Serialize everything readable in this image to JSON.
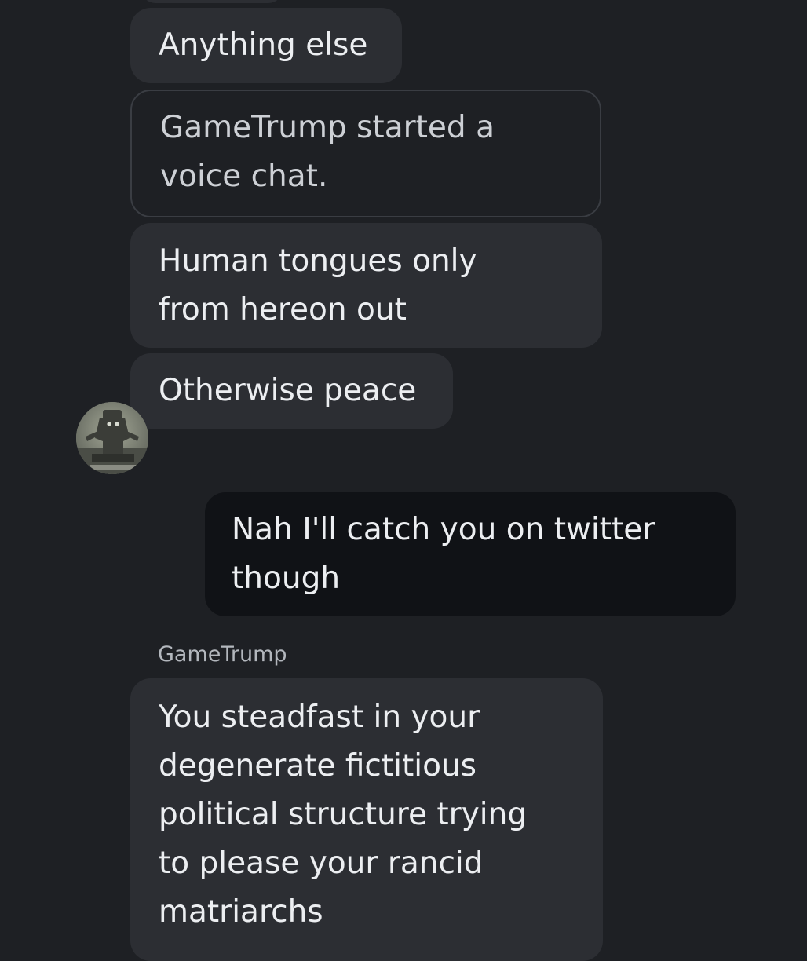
{
  "conversation": {
    "messages": [
      {
        "type": "incoming",
        "lines": [
          "Anything else"
        ]
      },
      {
        "type": "system",
        "lines": [
          "GameTrump started a",
          "voice chat."
        ]
      },
      {
        "type": "incoming",
        "lines": [
          "Human tongues only",
          "from hereon out"
        ]
      },
      {
        "type": "incoming",
        "lines": [
          "Otherwise peace"
        ]
      },
      {
        "type": "outgoing",
        "lines": [
          "Nah I'll catch you on twitter",
          "though"
        ]
      },
      {
        "type": "incoming",
        "sender": "GameTrump",
        "lines": [
          "You steadfast in your",
          "degenerate fictitious",
          "political structure trying",
          "to please your rancid",
          "matriarchs"
        ]
      }
    ]
  },
  "avatar": {
    "icon": "shadow-of-the-colossus-avatar-icon"
  },
  "colors": {
    "background": "#1e2024",
    "incoming_bubble": "#2c2e33",
    "outgoing_bubble": "#101216",
    "text": "#eceef1",
    "sender_name": "#b3b7bd"
  }
}
